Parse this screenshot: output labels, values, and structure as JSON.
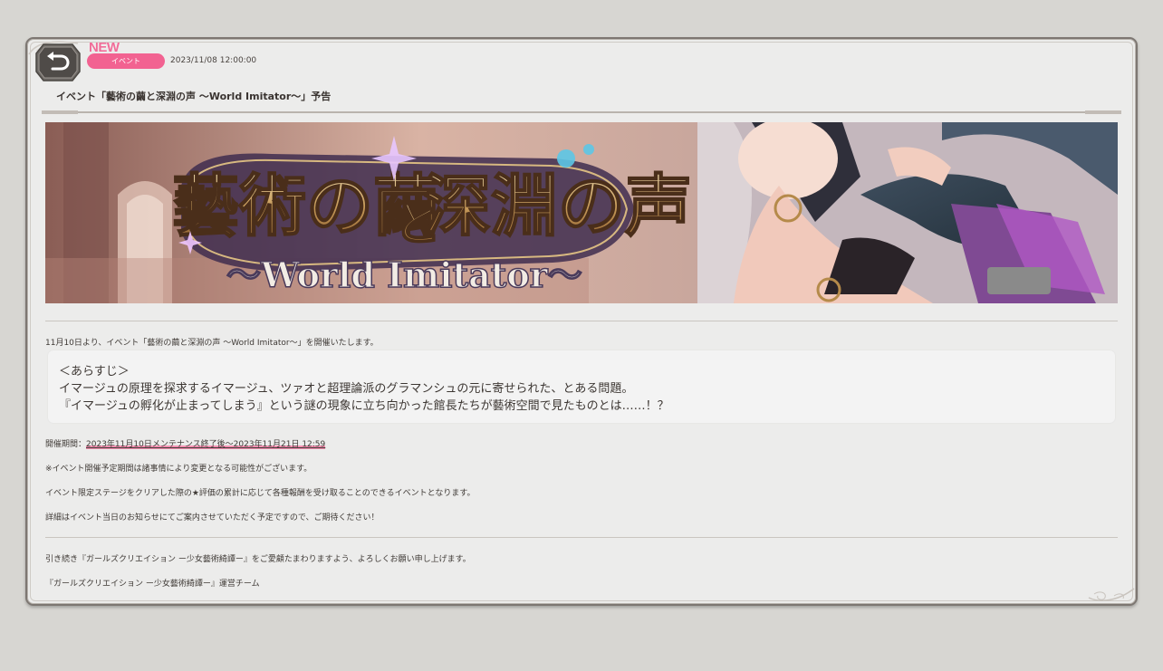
{
  "header": {
    "new_badge": "NEW",
    "category": "イベント",
    "date": "2023/11/08 12:00:00",
    "title": "イベント「藝術の繭と深淵の声 〜World Imitator〜」予告"
  },
  "banner": {
    "title_top_left": "藝術の繭",
    "title_connector": "と",
    "title_top_right": "深淵の声",
    "subtitle": "〜World Imitator〜"
  },
  "body": {
    "intro": "11月10日より、イベント「藝術の繭と深淵の声 〜World Imitator〜」を開催いたします。",
    "synopsis": {
      "heading": "＜あらすじ＞",
      "line1": "イマージュの原理を探求するイマージュ、ツァオと超理論派のグラマンシュの元に寄せられた、とある問題。",
      "line2": "『イマージュの孵化が止まってしまう』という謎の現象に立ち向かった館長たちが藝術空間で見たものとは……！？"
    },
    "period_label": "開催期間：",
    "period_value": "2023年11月10日メンテナンス終了後〜2023年11月21日 12:59",
    "note1": "※イベント開催予定期間は諸事情により変更となる可能性がございます。",
    "note2": "イベント限定ステージをクリアした際の★評価の累計に応じて各種報酬を受け取ることのできるイベントとなります。",
    "note3": "詳細はイベント当日のお知らせにてご案内させていただく予定ですので、ご期待ください！",
    "closing1": "引き続き『ガールズクリエイション ー少女藝術綺譚ー』をご愛顧たまわりますよう、よろしくお願い申し上げます。",
    "closing2": "『ガールズクリエイション ー少女藝術綺譚ー』運営チーム"
  },
  "icons": {
    "back": "back-arrow-icon"
  },
  "colors": {
    "accent_pink": "#f26291",
    "panel_bg": "#ececeb",
    "page_bg": "#d7d6d2"
  }
}
